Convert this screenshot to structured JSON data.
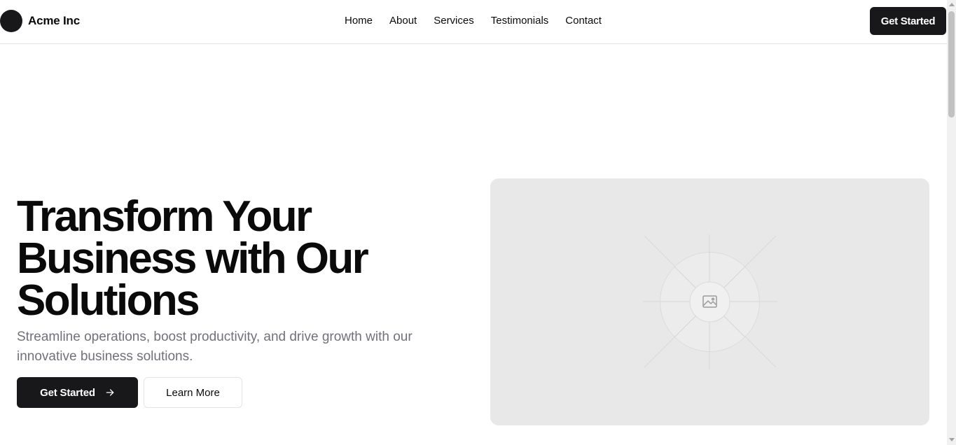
{
  "brand": {
    "name": "Acme Inc"
  },
  "nav": {
    "items": [
      {
        "label": "Home"
      },
      {
        "label": "About"
      },
      {
        "label": "Services"
      },
      {
        "label": "Testimonials"
      },
      {
        "label": "Contact"
      }
    ],
    "cta_label": "Get Started"
  },
  "hero": {
    "title_lines": [
      "Transform Your",
      "Business with Our",
      "Solutions"
    ],
    "subtitle": "Streamline operations, boost productivity, and drive growth with our innovative business solutions.",
    "primary_label": "Get Started",
    "secondary_label": "Learn More",
    "image_icon": "image-placeholder-icon"
  },
  "colors": {
    "primary": "#18181b",
    "muted_text": "#71717a",
    "placeholder_bg": "#e8e8e8",
    "border": "#e5e5e5"
  }
}
